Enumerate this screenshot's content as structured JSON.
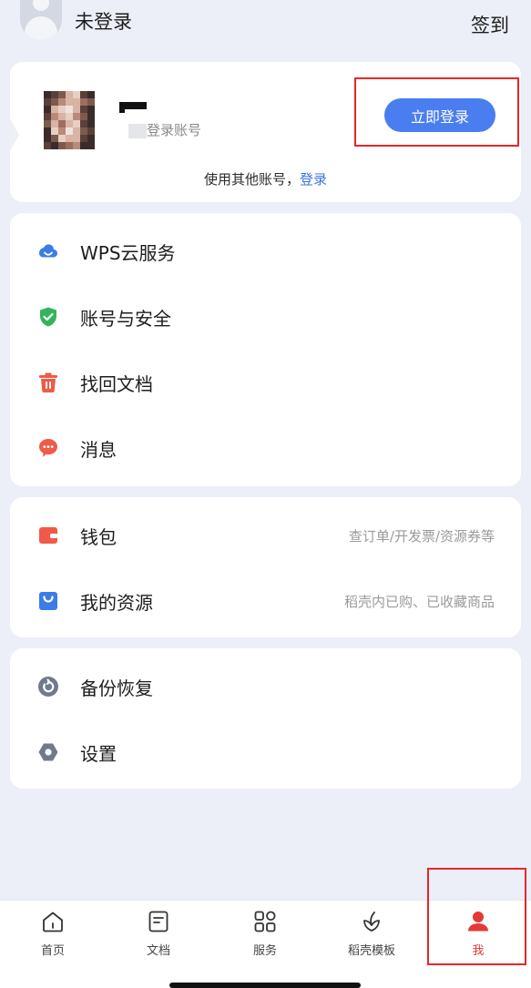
{
  "topbar": {
    "title": "未登录",
    "signin_label": "签到"
  },
  "login_card": {
    "sub_text": "登录账号",
    "button_label": "立即登录",
    "other_prefix": "使用其他账号，",
    "other_link": "登录"
  },
  "group1": [
    {
      "label": "WPS云服务",
      "icon": "cloud-icon",
      "color": "#3d7ce8"
    },
    {
      "label": "账号与安全",
      "icon": "shield-check-icon",
      "color": "#36b35a"
    },
    {
      "label": "找回文档",
      "icon": "trash-icon",
      "color": "#ef5a4a"
    },
    {
      "label": "消息",
      "icon": "chat-bubble-icon",
      "color": "#ef5a4a"
    }
  ],
  "group2": [
    {
      "label": "钱包",
      "hint": "查订单/开发票/资源券等",
      "icon": "wallet-icon",
      "color": "#ef5a4a"
    },
    {
      "label": "我的资源",
      "hint": "稻壳内已购、已收藏商品",
      "icon": "bag-icon",
      "color": "#3d7ce8"
    }
  ],
  "group3": [
    {
      "label": "备份恢复",
      "icon": "backup-icon",
      "color": "#6f7a8c"
    },
    {
      "label": "设置",
      "icon": "settings-icon",
      "color": "#6f7a8c"
    }
  ],
  "bottom_nav": [
    {
      "label": "首页",
      "icon": "home-icon"
    },
    {
      "label": "文档",
      "icon": "document-icon"
    },
    {
      "label": "服务",
      "icon": "apps-grid-icon"
    },
    {
      "label": "稻壳模板",
      "icon": "leaf-icon"
    },
    {
      "label": "我",
      "icon": "user-icon",
      "active": true
    }
  ],
  "colors": {
    "accent": "#4a7df0",
    "active_nav": "#e33a38",
    "highlight_box": "#e8262a"
  }
}
